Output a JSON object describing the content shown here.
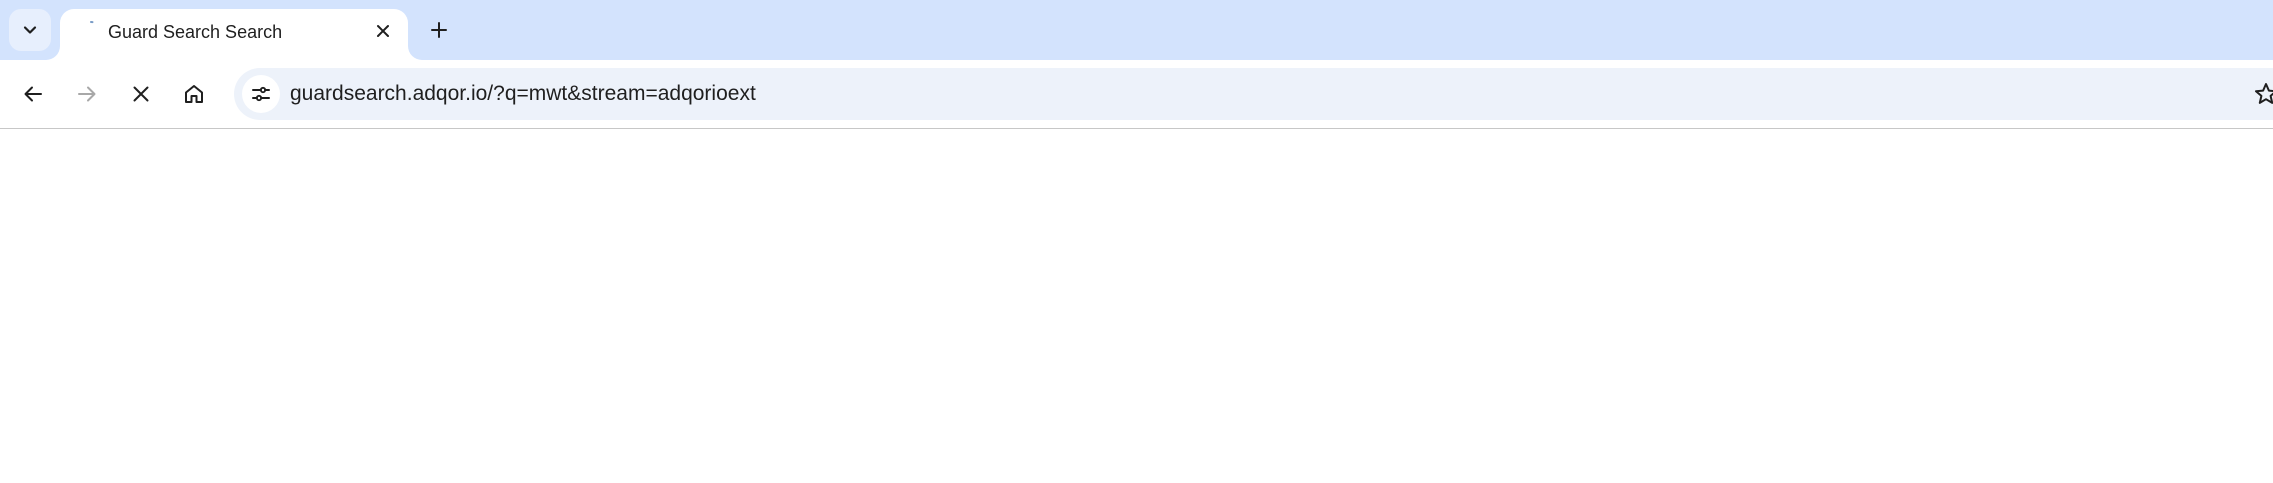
{
  "tab": {
    "title": "Guard Search Search"
  },
  "omnibox": {
    "url": "guardsearch.adqor.io/?q=mwt&stream=adqorioext"
  },
  "icons": {
    "tab_search": "chevron-down-icon",
    "favicon": "loading-spinner-icon",
    "tab_close": "close-icon",
    "new_tab": "plus-icon",
    "back": "arrow-left-icon",
    "forward": "arrow-right-icon",
    "stop": "close-icon",
    "home": "home-icon",
    "site_info": "tune-icon",
    "bookmark": "star-icon"
  },
  "colors": {
    "tabstrip": "#d3e3fd",
    "omnibox": "#edf2fa",
    "text": "#1f1f1f",
    "disabled": "#a8a8a8"
  }
}
